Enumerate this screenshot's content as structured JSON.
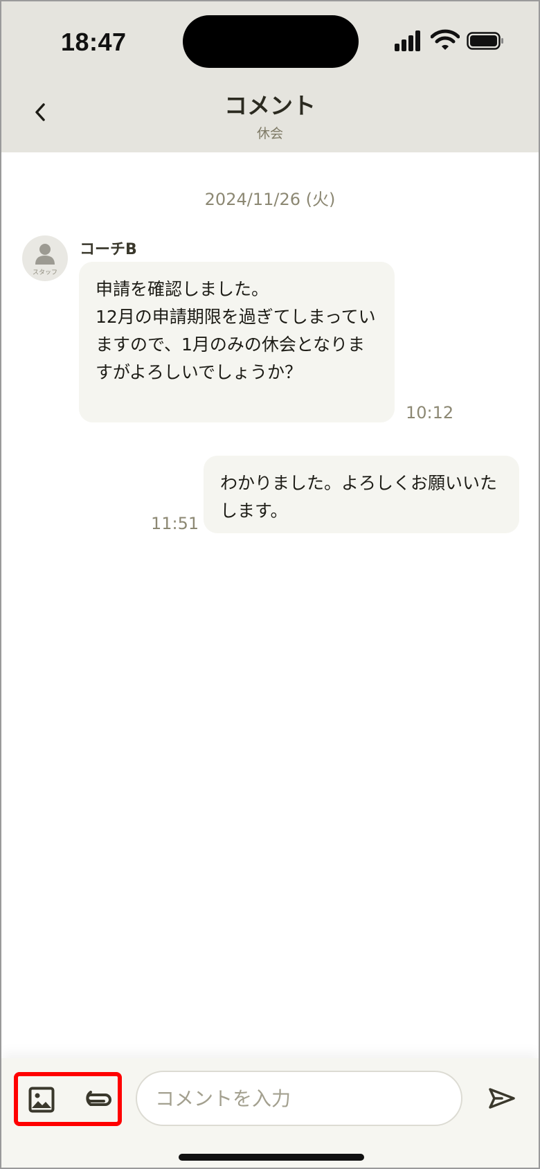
{
  "status_bar": {
    "time": "18:47"
  },
  "header": {
    "title": "コメント",
    "subtitle": "休会"
  },
  "chat": {
    "date": "2024/11/26 (火)",
    "messages": [
      {
        "sender": "コーチB",
        "avatar_label": "スタッフ",
        "text": "申請を確認しました。\n12月の申請期限を過ぎてしまっていますので、1月のみの休会となりますがよろしいでしょうか？",
        "time": "10:12"
      },
      {
        "text": "わかりました。よろしくお願いいたします。",
        "time": "11:51"
      }
    ]
  },
  "composer": {
    "placeholder": "コメントを入力",
    "value": ""
  },
  "icons": {
    "back": "chevron-left-icon",
    "image": "image-icon",
    "attach": "paperclip-icon",
    "send": "send-icon"
  },
  "colors": {
    "header_bg": "#e5e4de",
    "bubble_bg": "#f5f5f0",
    "highlight": "#ff0000",
    "muted_text": "#8c8873"
  }
}
